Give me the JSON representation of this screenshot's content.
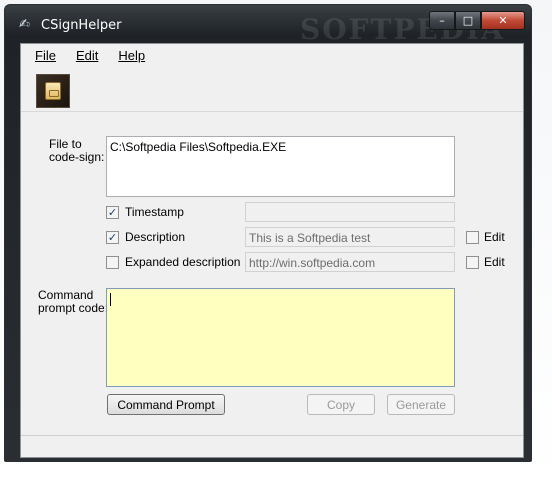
{
  "window": {
    "title": "CSignHelper",
    "watermark": "SOFTPEDIA",
    "controls": {
      "minimize": "–",
      "maximize": "□",
      "close": "✕"
    }
  },
  "menu": {
    "file": "File",
    "edit": "Edit",
    "help": "Help"
  },
  "toolbar": {
    "icon": "document-icon"
  },
  "form": {
    "file_label_1": "File to",
    "file_label_2": "code-sign:",
    "file_value": "C:\\Softpedia Files\\Softpedia.EXE",
    "timestamp": {
      "label": "Timestamp",
      "checked": true,
      "value": ""
    },
    "description": {
      "label": "Description",
      "checked": true,
      "value": "This is a Softpedia test",
      "edit_label": "Edit",
      "edit_checked": false
    },
    "expanded": {
      "label": "Expanded description",
      "checked": false,
      "value": "http://win.softpedia.com",
      "edit_label": "Edit",
      "edit_checked": false
    },
    "cmd_label_1": "Command",
    "cmd_label_2": "prompt code:",
    "cmd_value": ""
  },
  "buttons": {
    "command_prompt": "Command Prompt",
    "copy": "Copy",
    "generate": "Generate"
  },
  "colors": {
    "command_area_bg": "#ffffc0",
    "client_bg": "#f0f0f0"
  }
}
